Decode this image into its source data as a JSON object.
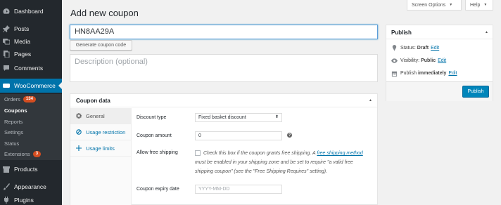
{
  "sidebar": {
    "items": [
      {
        "label": "Dashboard",
        "icon": "dashboard-icon"
      },
      {
        "label": "Posts",
        "icon": "pin-icon"
      },
      {
        "label": "Media",
        "icon": "media-icon"
      },
      {
        "label": "Pages",
        "icon": "pages-icon"
      },
      {
        "label": "Comments",
        "icon": "comment-icon"
      },
      {
        "label": "WooCommerce",
        "icon": "woo-icon"
      },
      {
        "label": "Products",
        "icon": "archive-icon"
      },
      {
        "label": "Appearance",
        "icon": "brush-icon"
      },
      {
        "label": "Plugins",
        "icon": "plug-icon"
      }
    ],
    "woo_submenu": [
      {
        "label": "Orders",
        "badge": "134"
      },
      {
        "label": "Coupons"
      },
      {
        "label": "Reports"
      },
      {
        "label": "Settings"
      },
      {
        "label": "Status"
      },
      {
        "label": "Extensions",
        "badge": "3"
      }
    ]
  },
  "header": {
    "screen_options": "Screen Options",
    "help": "Help",
    "title": "Add new coupon"
  },
  "coupon": {
    "code": "HN8AA29A",
    "generate_label": "Generate coupon code",
    "description_placeholder": "Description (optional)"
  },
  "coupon_data": {
    "title": "Coupon data",
    "tabs": [
      {
        "label": "General",
        "icon": "gear-icon"
      },
      {
        "label": "Usage restriction",
        "icon": "block-icon"
      },
      {
        "label": "Usage limits",
        "icon": "plus-icon"
      }
    ],
    "fields": {
      "discount_type_label": "Discount type",
      "discount_type_value": "Fixed basket discount",
      "coupon_amount_label": "Coupon amount",
      "coupon_amount_value": "0",
      "free_shipping_label": "Allow free shipping",
      "free_shipping_text_1": "Check this box if the coupon grants free shipping. A",
      "free_shipping_link": "free shipping method",
      "free_shipping_text_2": "must be enabled in your shipping zone and be set to require \"a valid free shipping coupon\" (see the \"Free Shipping Requires\" setting).",
      "expiry_label": "Coupon expiry date",
      "expiry_placeholder": "YYYY-MM-DD"
    }
  },
  "publish": {
    "title": "Publish",
    "status_label": "Status:",
    "status_value": "Draft",
    "visibility_label": "Visibility:",
    "visibility_value": "Public",
    "publish_label": "Publish",
    "publish_value": "immediately",
    "edit": "Edit",
    "button": "Publish"
  },
  "colors": {
    "sidebar_bg": "#23282d",
    "accent": "#0073aa",
    "badge": "#d54e21",
    "primary_button": "#0085ba"
  }
}
